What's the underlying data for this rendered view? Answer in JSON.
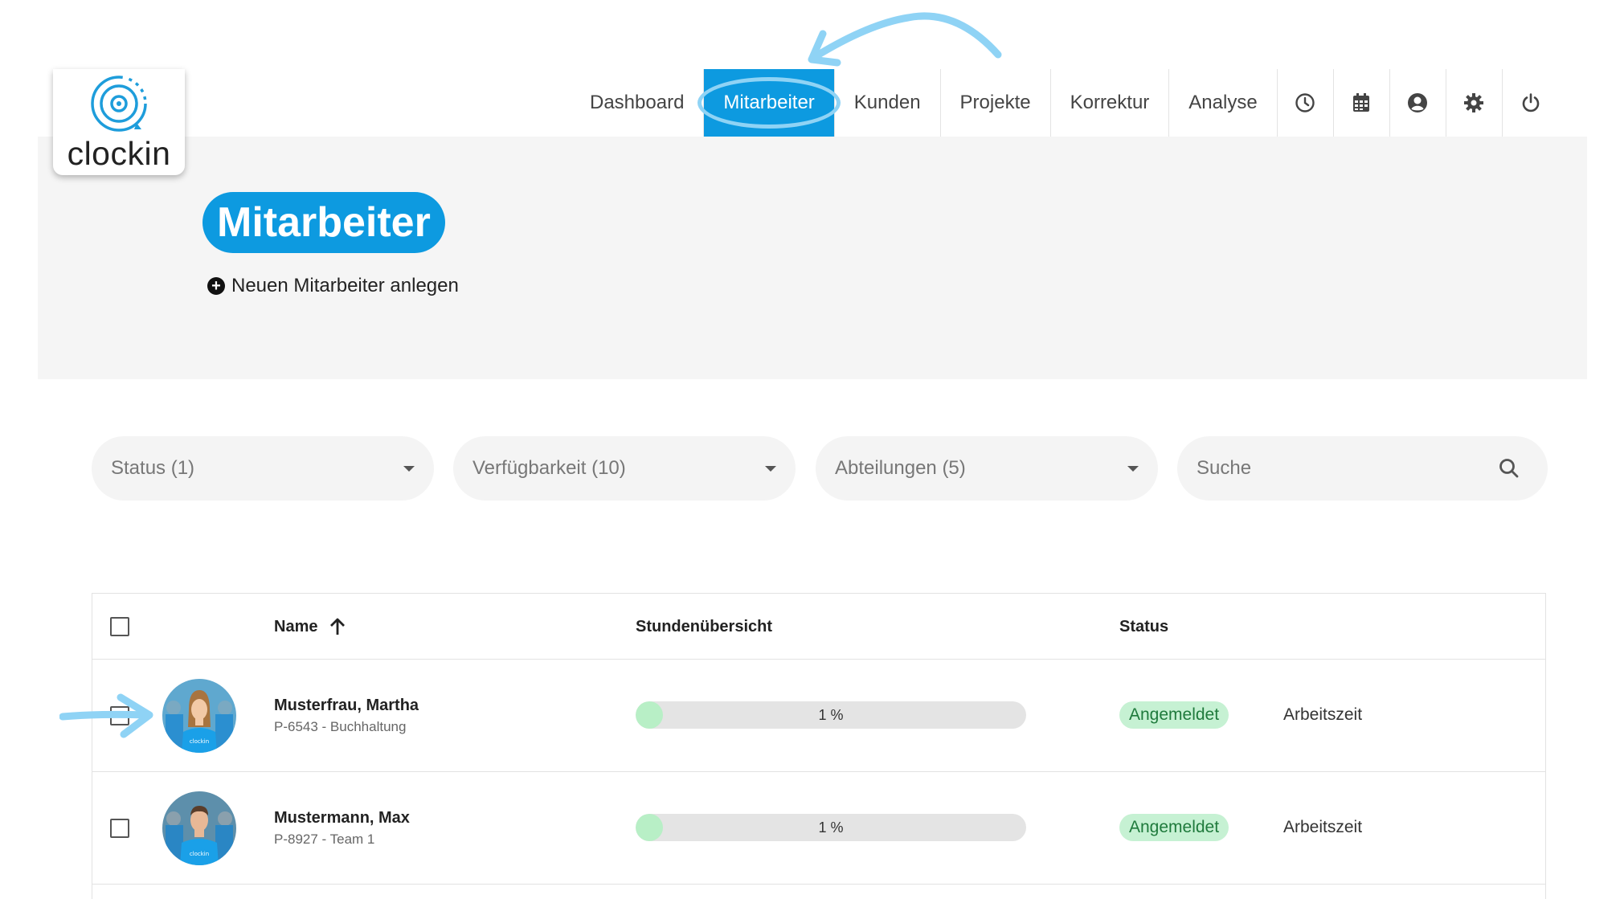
{
  "app": {
    "logo_text": "clockin"
  },
  "nav": {
    "items": [
      {
        "label": "Dashboard",
        "active": false
      },
      {
        "label": "Mitarbeiter",
        "active": true
      },
      {
        "label": "Kunden",
        "active": false
      },
      {
        "label": "Projekte",
        "active": false
      },
      {
        "label": "Korrektur",
        "active": false
      },
      {
        "label": "Analyse",
        "active": false
      }
    ],
    "icons": [
      "clock-icon",
      "calendar-icon",
      "user-circle-icon",
      "gear-icon",
      "power-icon"
    ]
  },
  "page": {
    "title": "Mitarbeiter",
    "add_employee_label": "Neuen Mitarbeiter anlegen"
  },
  "filters": {
    "status": "Status (1)",
    "availability": "Verfügbarkeit (10)",
    "departments": "Abteilungen (5)",
    "search_placeholder": "Suche"
  },
  "table": {
    "columns": {
      "name": "Name",
      "hours": "Stundenübersicht",
      "status": "Status"
    },
    "rows": [
      {
        "name": "Musterfrau, Martha",
        "sub": "P-6543 - Buchhaltung",
        "progress_label": "1 %",
        "progress": 0.01,
        "status": "Angemeldet",
        "action": "Arbeitszeit"
      },
      {
        "name": "Mustermann, Max",
        "sub": "P-8927 - Team 1",
        "progress_label": "1 %",
        "progress": 0.01,
        "status": "Angemeldet",
        "action": "Arbeitszeit"
      }
    ]
  },
  "colors": {
    "accent": "#0d9ae0",
    "annotation": "#8fd3f5",
    "status_bg": "#c6f1d3",
    "progress_fill": "#b8efc6"
  }
}
